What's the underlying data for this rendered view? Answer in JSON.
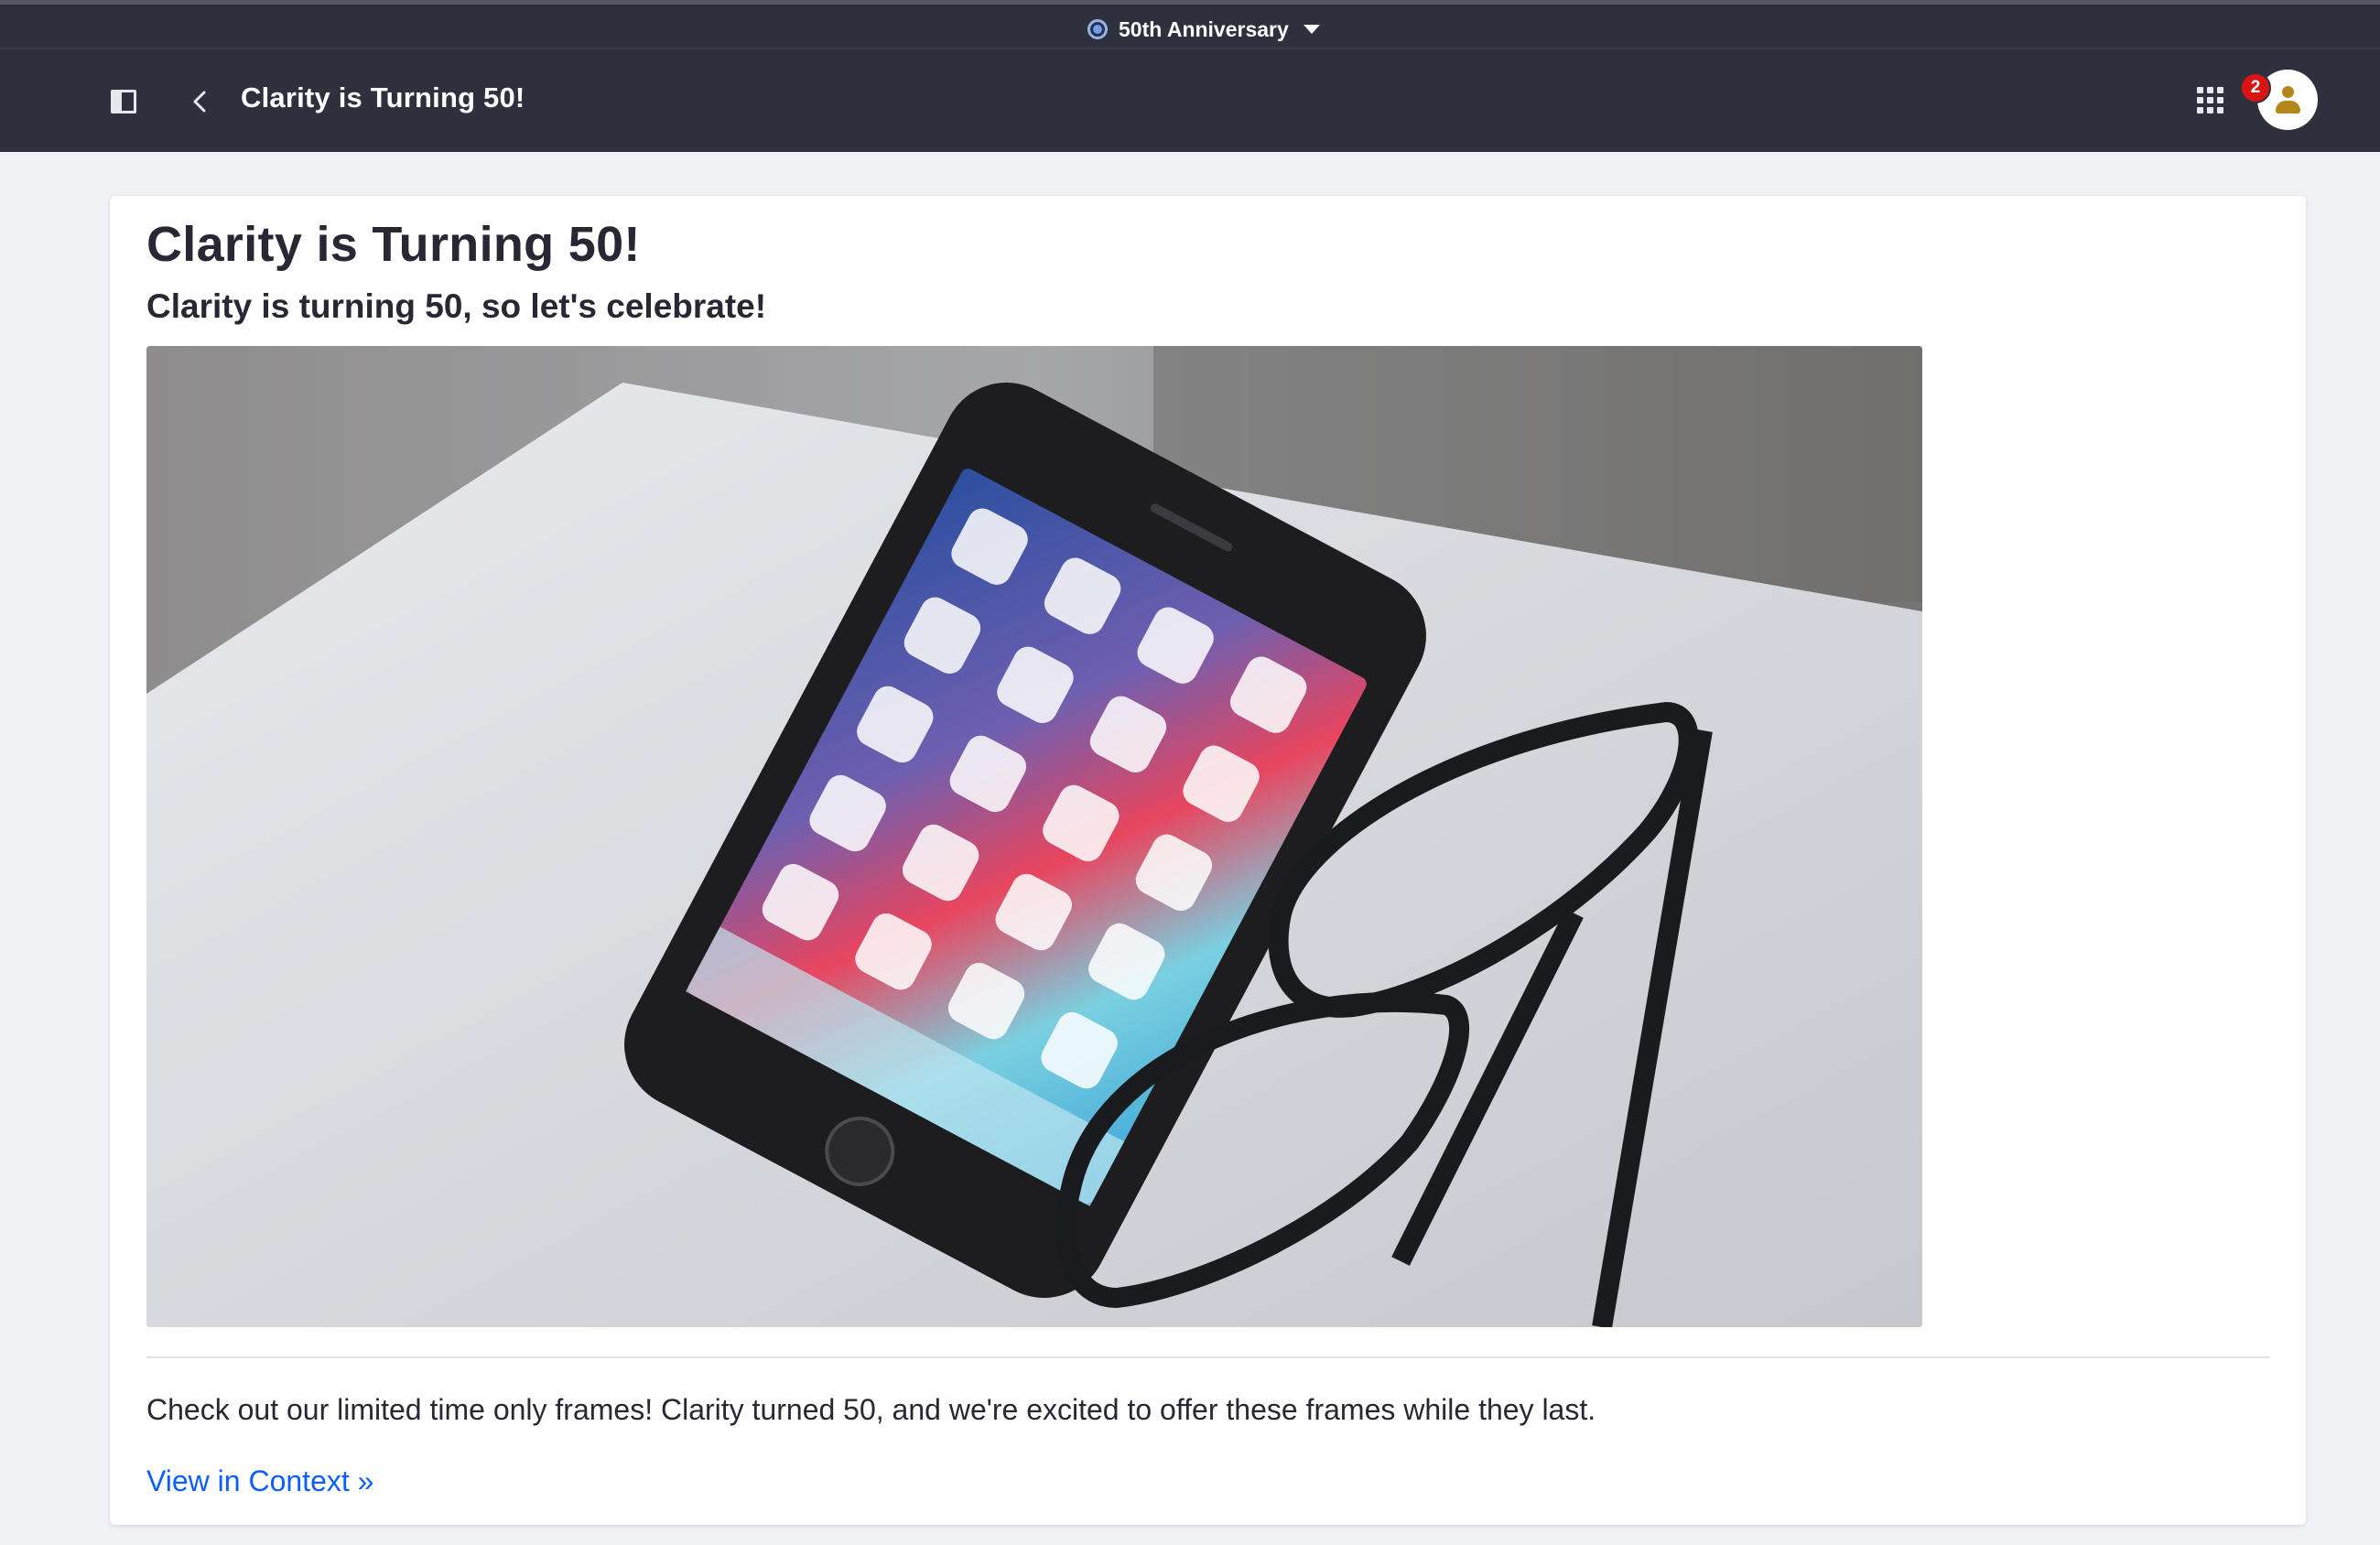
{
  "site_bar": {
    "site_name": "50th Anniversary",
    "site_icon": "radio-dot-icon",
    "dropdown_icon": "caret-down-icon"
  },
  "header": {
    "title": "Clarity is Turning 50!",
    "panel_icon": "product-menu-toggle-icon",
    "back_icon": "chevron-left-icon",
    "apps_icon": "apps-grid-icon",
    "notification_count": "2",
    "avatar_icon": "user-avatar-icon"
  },
  "article": {
    "title": "Clarity is Turning 50!",
    "subtitle": "Clarity is turning 50, so let's celebrate!",
    "image_description": "smartphone and eyeglasses on a white table",
    "body": "Check out our limited time only frames! Clarity turned 50, and we're excited to offer these frames while they last.",
    "link_label": "View in Context »"
  },
  "colors": {
    "header_bg": "#2e303d",
    "page_bg": "#f0f1f4",
    "link": "#0b5fff",
    "badge": "#da1414",
    "avatar_accent": "#b5861c"
  }
}
